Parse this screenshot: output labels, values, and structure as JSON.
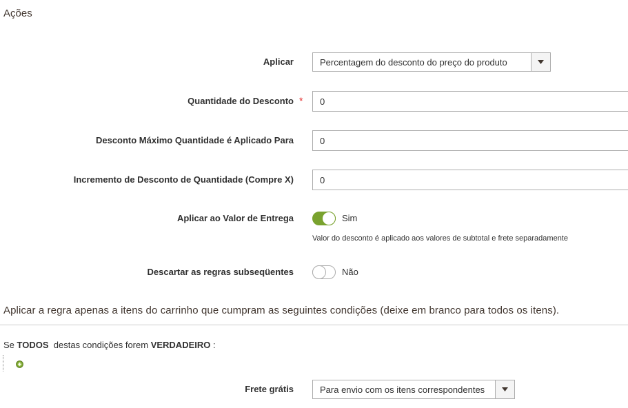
{
  "section": {
    "title": "Ações"
  },
  "fields": {
    "apply": {
      "label": "Aplicar",
      "value": "Percentagem do desconto do preço do produto"
    },
    "discount_amount": {
      "label": "Quantidade do Desconto",
      "value": "0",
      "required_mark": "*"
    },
    "max_qty": {
      "label": "Desconto Máximo Quantidade é Aplicado Para",
      "value": "0"
    },
    "step": {
      "label": "Incremento de Desconto de Quantidade (Compre X)",
      "value": "0"
    },
    "apply_shipping": {
      "label": "Aplicar ao Valor de Entrega",
      "state": "Sim",
      "on": true,
      "note": "Valor do desconto é aplicado aos valores de subtotal e frete separadamente"
    },
    "discard": {
      "label": "Descartar as regras subseqüentes",
      "state": "Não",
      "on": false
    }
  },
  "conditions": {
    "title": "Aplicar a regra apenas a itens do carrinho que cumpram as seguintes condições (deixe em branco para todos os itens).",
    "prefix": "Se",
    "aggregator": "TODOS",
    "middle": "destas condições forem",
    "value": "VERDADEIRO",
    "suffix": ":"
  },
  "free_shipping": {
    "label": "Frete grátis",
    "value": "Para envio com os itens correspondentes"
  },
  "colors": {
    "toggle_on": "#79a22e",
    "required": "#e22626",
    "add_icon": "#79a22e"
  }
}
